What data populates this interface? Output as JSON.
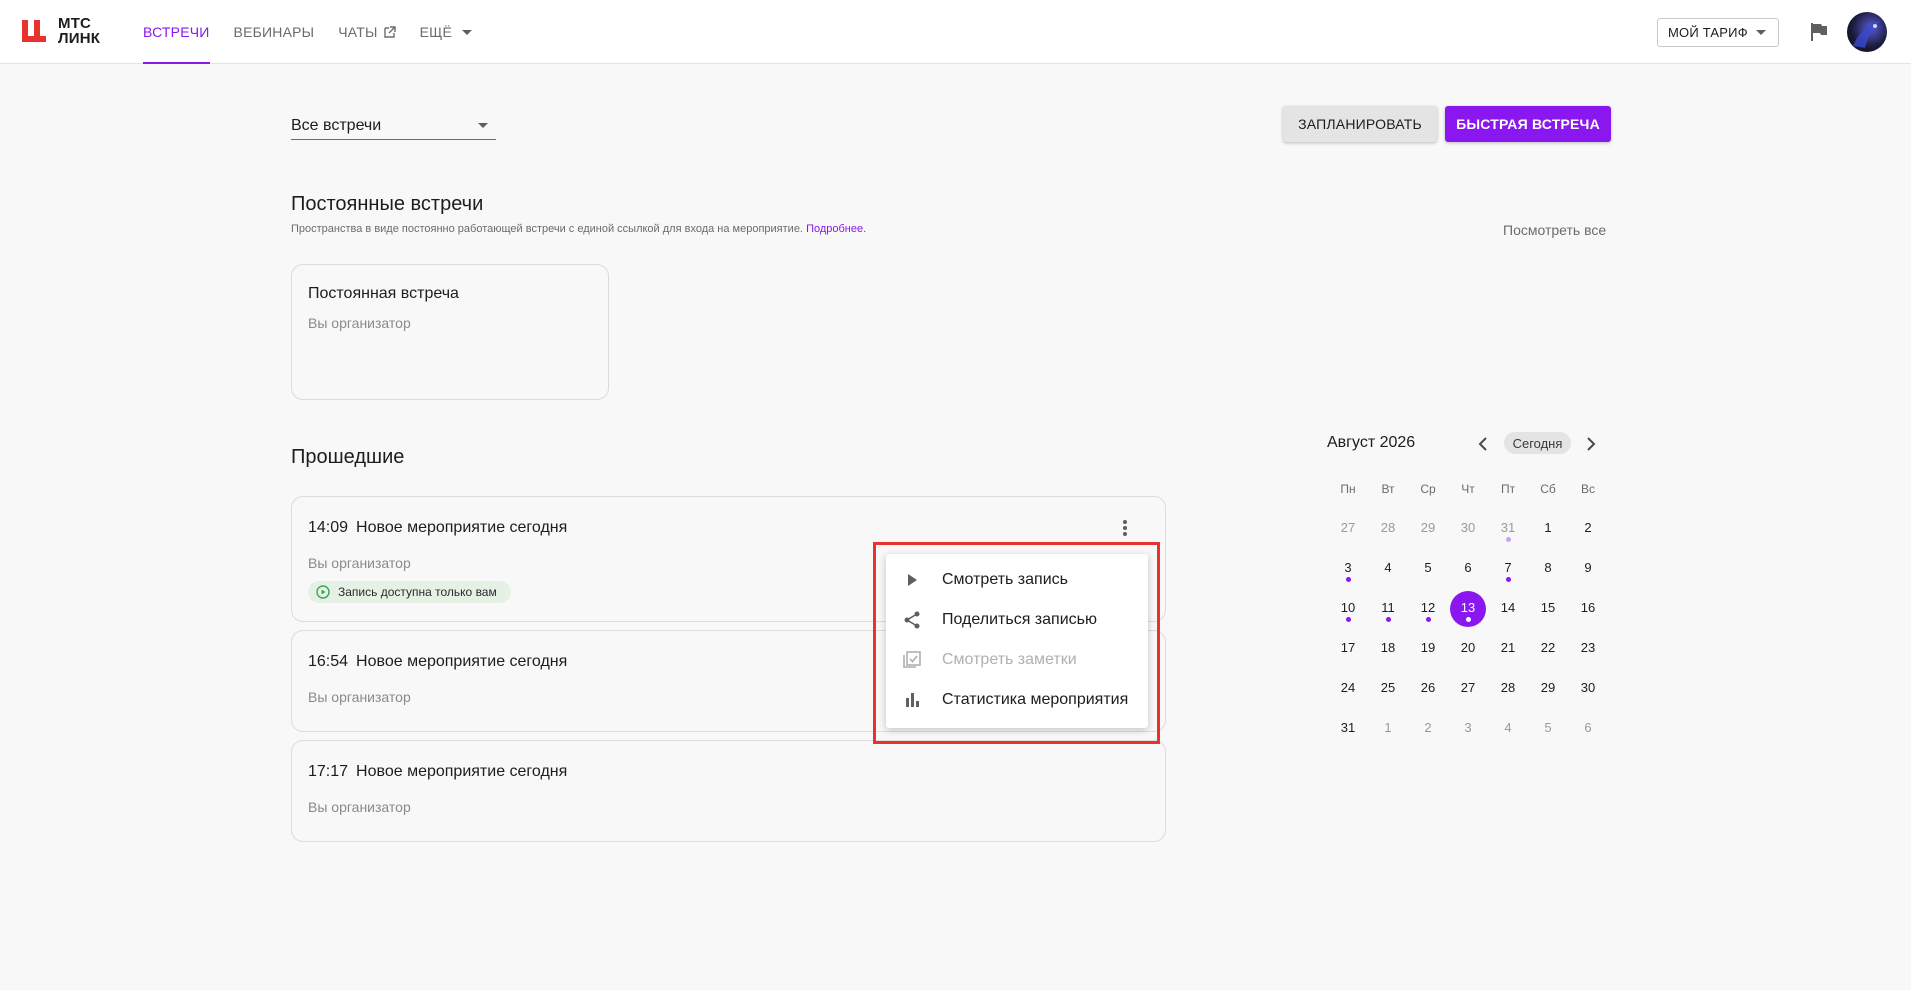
{
  "app": {
    "logo_line1": "МТС",
    "logo_line2": "ЛИНК",
    "brand_color": "#8a17f0"
  },
  "nav": {
    "items": [
      {
        "label": "ВСТРЕЧИ",
        "active": true
      },
      {
        "label": "ВЕБИНАРЫ",
        "active": false
      },
      {
        "label": "ЧАТЫ",
        "active": false,
        "icon": "external-link-icon"
      },
      {
        "label": "ЕЩЁ",
        "active": false,
        "icon": "chevron-down-icon"
      }
    ]
  },
  "header": {
    "tariff_label": "МОЙ ТАРИФ",
    "flag_icon": "flag-icon",
    "avatar_icon": "user-avatar"
  },
  "toolbar": {
    "filter_value": "Все встречи",
    "plan_label": "ЗАПЛАНИРОВАТЬ",
    "quick_label": "БЫСТРАЯ ВСТРЕЧА"
  },
  "permanent": {
    "title": "Постоянные встречи",
    "subtitle": "Пространства в виде постоянно работающей встречи с единой ссылкой для входа на мероприятие.",
    "subtitle_link": "Подробнее.",
    "see_all": "Посмотреть все",
    "card": {
      "title": "Постоянная встреча",
      "role": "Вы организатор"
    }
  },
  "past": {
    "title": "Прошедшие",
    "events": [
      {
        "time": "14:09",
        "name": "Новое мероприятие сегодня",
        "role": "Вы организатор",
        "badge": "Запись доступна только вам"
      },
      {
        "time": "16:54",
        "name": "Новое мероприятие сегодня",
        "role": "Вы организатор"
      },
      {
        "time": "17:17",
        "name": "Новое мероприятие сегодня",
        "role": "Вы организатор"
      }
    ]
  },
  "context_menu": {
    "items": [
      {
        "label": "Смотреть запись",
        "icon": "play-icon",
        "disabled": false
      },
      {
        "label": "Поделиться записью",
        "icon": "share-icon",
        "disabled": false
      },
      {
        "label": "Смотреть заметки",
        "icon": "notes-icon",
        "disabled": true
      },
      {
        "label": "Статистика мероприятия",
        "icon": "bar-chart-icon",
        "disabled": false
      }
    ]
  },
  "calendar": {
    "title": "Август 2026",
    "today_label": "Сегодня",
    "weekdays": [
      "Пн",
      "Вт",
      "Ср",
      "Чт",
      "Пт",
      "Сб",
      "Вс"
    ],
    "weeks": [
      [
        {
          "d": "27",
          "m": true
        },
        {
          "d": "28",
          "m": true
        },
        {
          "d": "29",
          "m": true
        },
        {
          "d": "30",
          "m": true
        },
        {
          "d": "31",
          "m": true,
          "dot": "light"
        },
        {
          "d": "1"
        },
        {
          "d": "2"
        }
      ],
      [
        {
          "d": "3",
          "dot": "dark"
        },
        {
          "d": "4"
        },
        {
          "d": "5"
        },
        {
          "d": "6"
        },
        {
          "d": "7",
          "dot": "dark"
        },
        {
          "d": "8"
        },
        {
          "d": "9"
        }
      ],
      [
        {
          "d": "10",
          "dot": "dark"
        },
        {
          "d": "11",
          "dot": "dark"
        },
        {
          "d": "12",
          "dot": "dark"
        },
        {
          "d": "13",
          "today": true,
          "dot": "dark"
        },
        {
          "d": "14"
        },
        {
          "d": "15"
        },
        {
          "d": "16"
        }
      ],
      [
        {
          "d": "17"
        },
        {
          "d": "18"
        },
        {
          "d": "19"
        },
        {
          "d": "20"
        },
        {
          "d": "21"
        },
        {
          "d": "22"
        },
        {
          "d": "23"
        }
      ],
      [
        {
          "d": "24"
        },
        {
          "d": "25"
        },
        {
          "d": "26"
        },
        {
          "d": "27"
        },
        {
          "d": "28"
        },
        {
          "d": "29"
        },
        {
          "d": "30"
        }
      ],
      [
        {
          "d": "31"
        },
        {
          "d": "1",
          "m": true
        },
        {
          "d": "2",
          "m": true
        },
        {
          "d": "3",
          "m": true
        },
        {
          "d": "4",
          "m": true
        },
        {
          "d": "5",
          "m": true
        },
        {
          "d": "6",
          "m": true
        }
      ]
    ]
  }
}
